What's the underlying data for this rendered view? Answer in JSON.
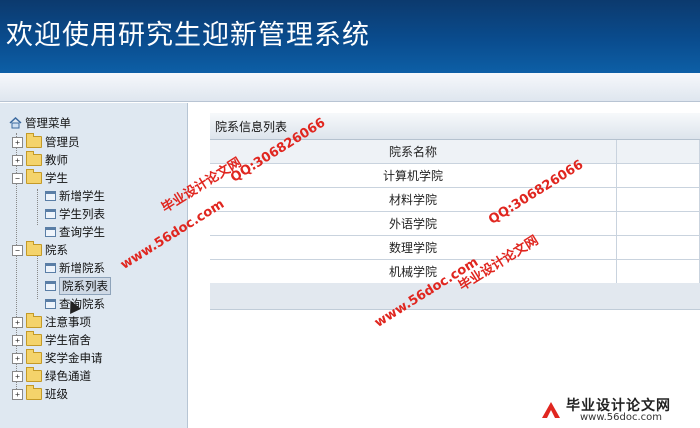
{
  "header": {
    "title": "欢迎使用研究生迎新管理系统"
  },
  "sidebar": {
    "root": "管理菜单",
    "items": [
      {
        "label": "管理员",
        "expanded": false
      },
      {
        "label": "教师",
        "expanded": false
      },
      {
        "label": "学生",
        "expanded": true,
        "children": [
          "新增学生",
          "学生列表",
          "查询学生"
        ]
      },
      {
        "label": "院系",
        "expanded": true,
        "children": [
          "新增院系",
          "院系列表",
          "查询院系"
        ],
        "selected_child": "院系列表"
      },
      {
        "label": "注意事项",
        "expanded": false
      },
      {
        "label": "学生宿舍",
        "expanded": false
      },
      {
        "label": "奖学金申请",
        "expanded": false
      },
      {
        "label": "绿色通道",
        "expanded": false
      },
      {
        "label": "班级",
        "expanded": false
      }
    ]
  },
  "main": {
    "title": "院系信息列表",
    "table": {
      "headers": [
        "院系名称",
        ""
      ],
      "rows": [
        [
          "计算机学院",
          ""
        ],
        [
          "材料学院",
          ""
        ],
        [
          "外语学院",
          ""
        ],
        [
          "数理学院",
          ""
        ],
        [
          "机械学院",
          ""
        ]
      ]
    }
  },
  "watermarks": {
    "site_cn": "毕业设计论文网",
    "url": "www.56doc.com",
    "qq": "QQ:306826066",
    "logo_cn": "毕业设计论文网",
    "logo_url": "www.56doc.com"
  },
  "colors": {
    "header_bg": "#0a4c8e",
    "sidebar_bg": "#dfe8f1",
    "watermark": "#e0261f"
  }
}
